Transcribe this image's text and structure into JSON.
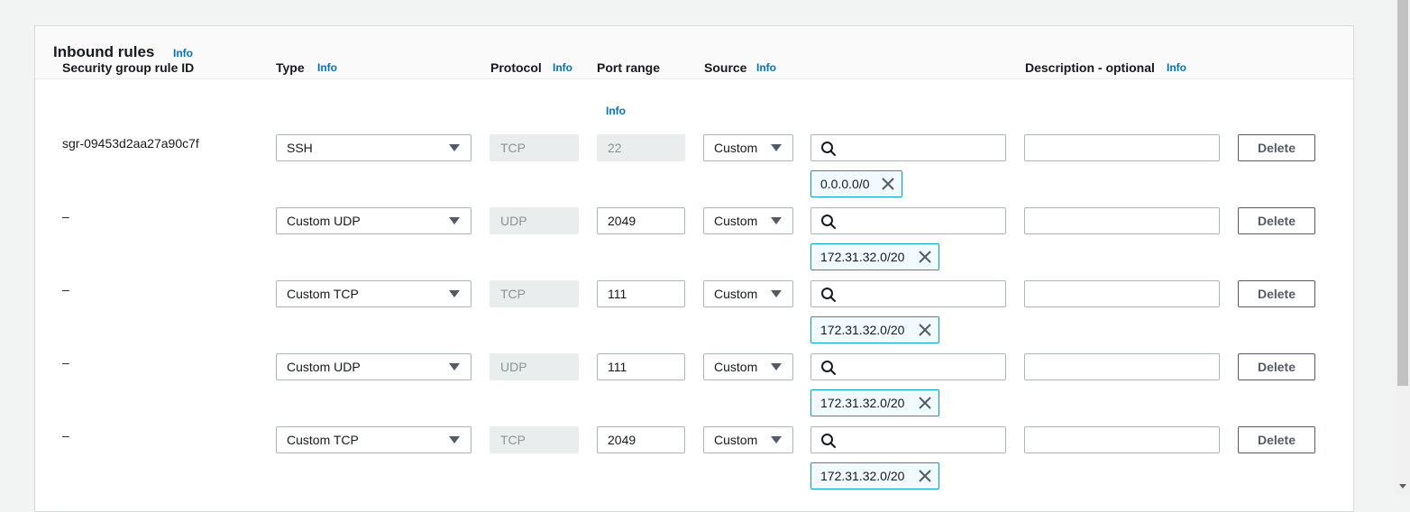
{
  "panel": {
    "title": "Inbound rules",
    "info": "Info"
  },
  "columns": {
    "rule_id": "Security group rule ID",
    "type": "Type",
    "type_info": "Info",
    "protocol": "Protocol",
    "protocol_info": "Info",
    "port_range": "Port range",
    "port_range_info": "Info",
    "source": "Source",
    "source_info": "Info",
    "description": "Description - optional",
    "description_info": "Info"
  },
  "rows": [
    {
      "id": "sgr-09453d2aa27a90c7f",
      "type": "SSH",
      "protocol": "TCP",
      "port": "22",
      "port_disabled": true,
      "source": "Custom",
      "cidr": "0.0.0.0/0",
      "delete": "Delete"
    },
    {
      "id": "–",
      "type": "Custom UDP",
      "protocol": "UDP",
      "port": "2049",
      "port_disabled": false,
      "source": "Custom",
      "cidr": "172.31.32.0/20",
      "delete": "Delete"
    },
    {
      "id": "–",
      "type": "Custom TCP",
      "protocol": "TCP",
      "port": "111",
      "port_disabled": false,
      "source": "Custom",
      "cidr": "172.31.32.0/20",
      "delete": "Delete"
    },
    {
      "id": "–",
      "type": "Custom UDP",
      "protocol": "UDP",
      "port": "111",
      "port_disabled": false,
      "source": "Custom",
      "cidr": "172.31.32.0/20",
      "delete": "Delete"
    },
    {
      "id": "–",
      "type": "Custom TCP",
      "protocol": "TCP",
      "port": "2049",
      "port_disabled": false,
      "source": "Custom",
      "cidr": "172.31.32.0/20",
      "delete": "Delete"
    }
  ],
  "icons": {
    "search": "search-icon",
    "remove": "close-icon",
    "dropdown": "caret-down-icon"
  },
  "colors": {
    "link": "#0073bb",
    "token_border": "#00a1c9",
    "token_bg": "#f1faff"
  }
}
